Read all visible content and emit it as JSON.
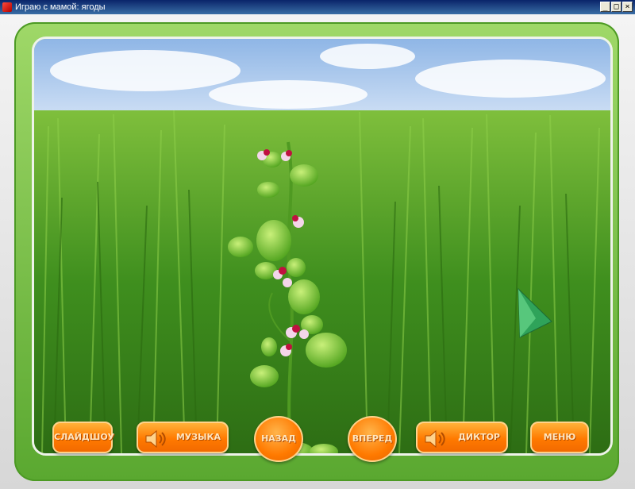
{
  "window": {
    "title": "Играю с мамой: ягоды",
    "controls": {
      "minimize": "_",
      "maximize": "□",
      "close": "×"
    }
  },
  "toolbar": {
    "slideshow": "СЛАЙДШОУ",
    "music": "МУЗЫКА",
    "back": "НАЗАД",
    "forward": "ВПЕРЕД",
    "narrator": "ДИКТОР",
    "menu": "МЕНЮ"
  },
  "colors": {
    "panel_green": "#7cc443",
    "button_orange": "#ff7a00",
    "arrow_green": "#2fa35a"
  },
  "icons": [
    "speaker-icon",
    "arrow-cursor-icon",
    "app-icon"
  ]
}
